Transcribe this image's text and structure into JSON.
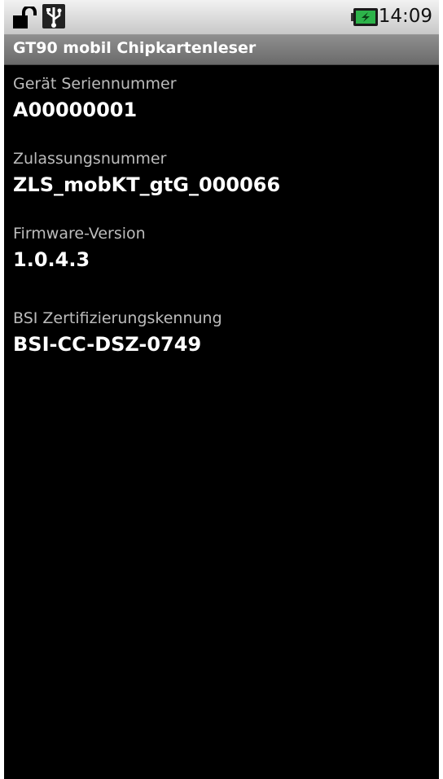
{
  "status_bar": {
    "time": "14:09",
    "icons": [
      "lock-open-icon",
      "usb-icon",
      "battery-charging-icon"
    ],
    "battery_color": "#2db34a"
  },
  "app": {
    "title": "GT90 mobil Chipkartenleser"
  },
  "fields": [
    {
      "label": "Gerät Seriennummer",
      "value": "A00000001"
    },
    {
      "label": "Zulassungsnummer",
      "value": "ZLS_mobKT_gtG_000066"
    },
    {
      "label": "Firmware-Version",
      "value": "1.0.4.3"
    },
    {
      "label": "BSI Zertifizierungskennung",
      "value": "BSI-CC-DSZ-0749"
    }
  ]
}
